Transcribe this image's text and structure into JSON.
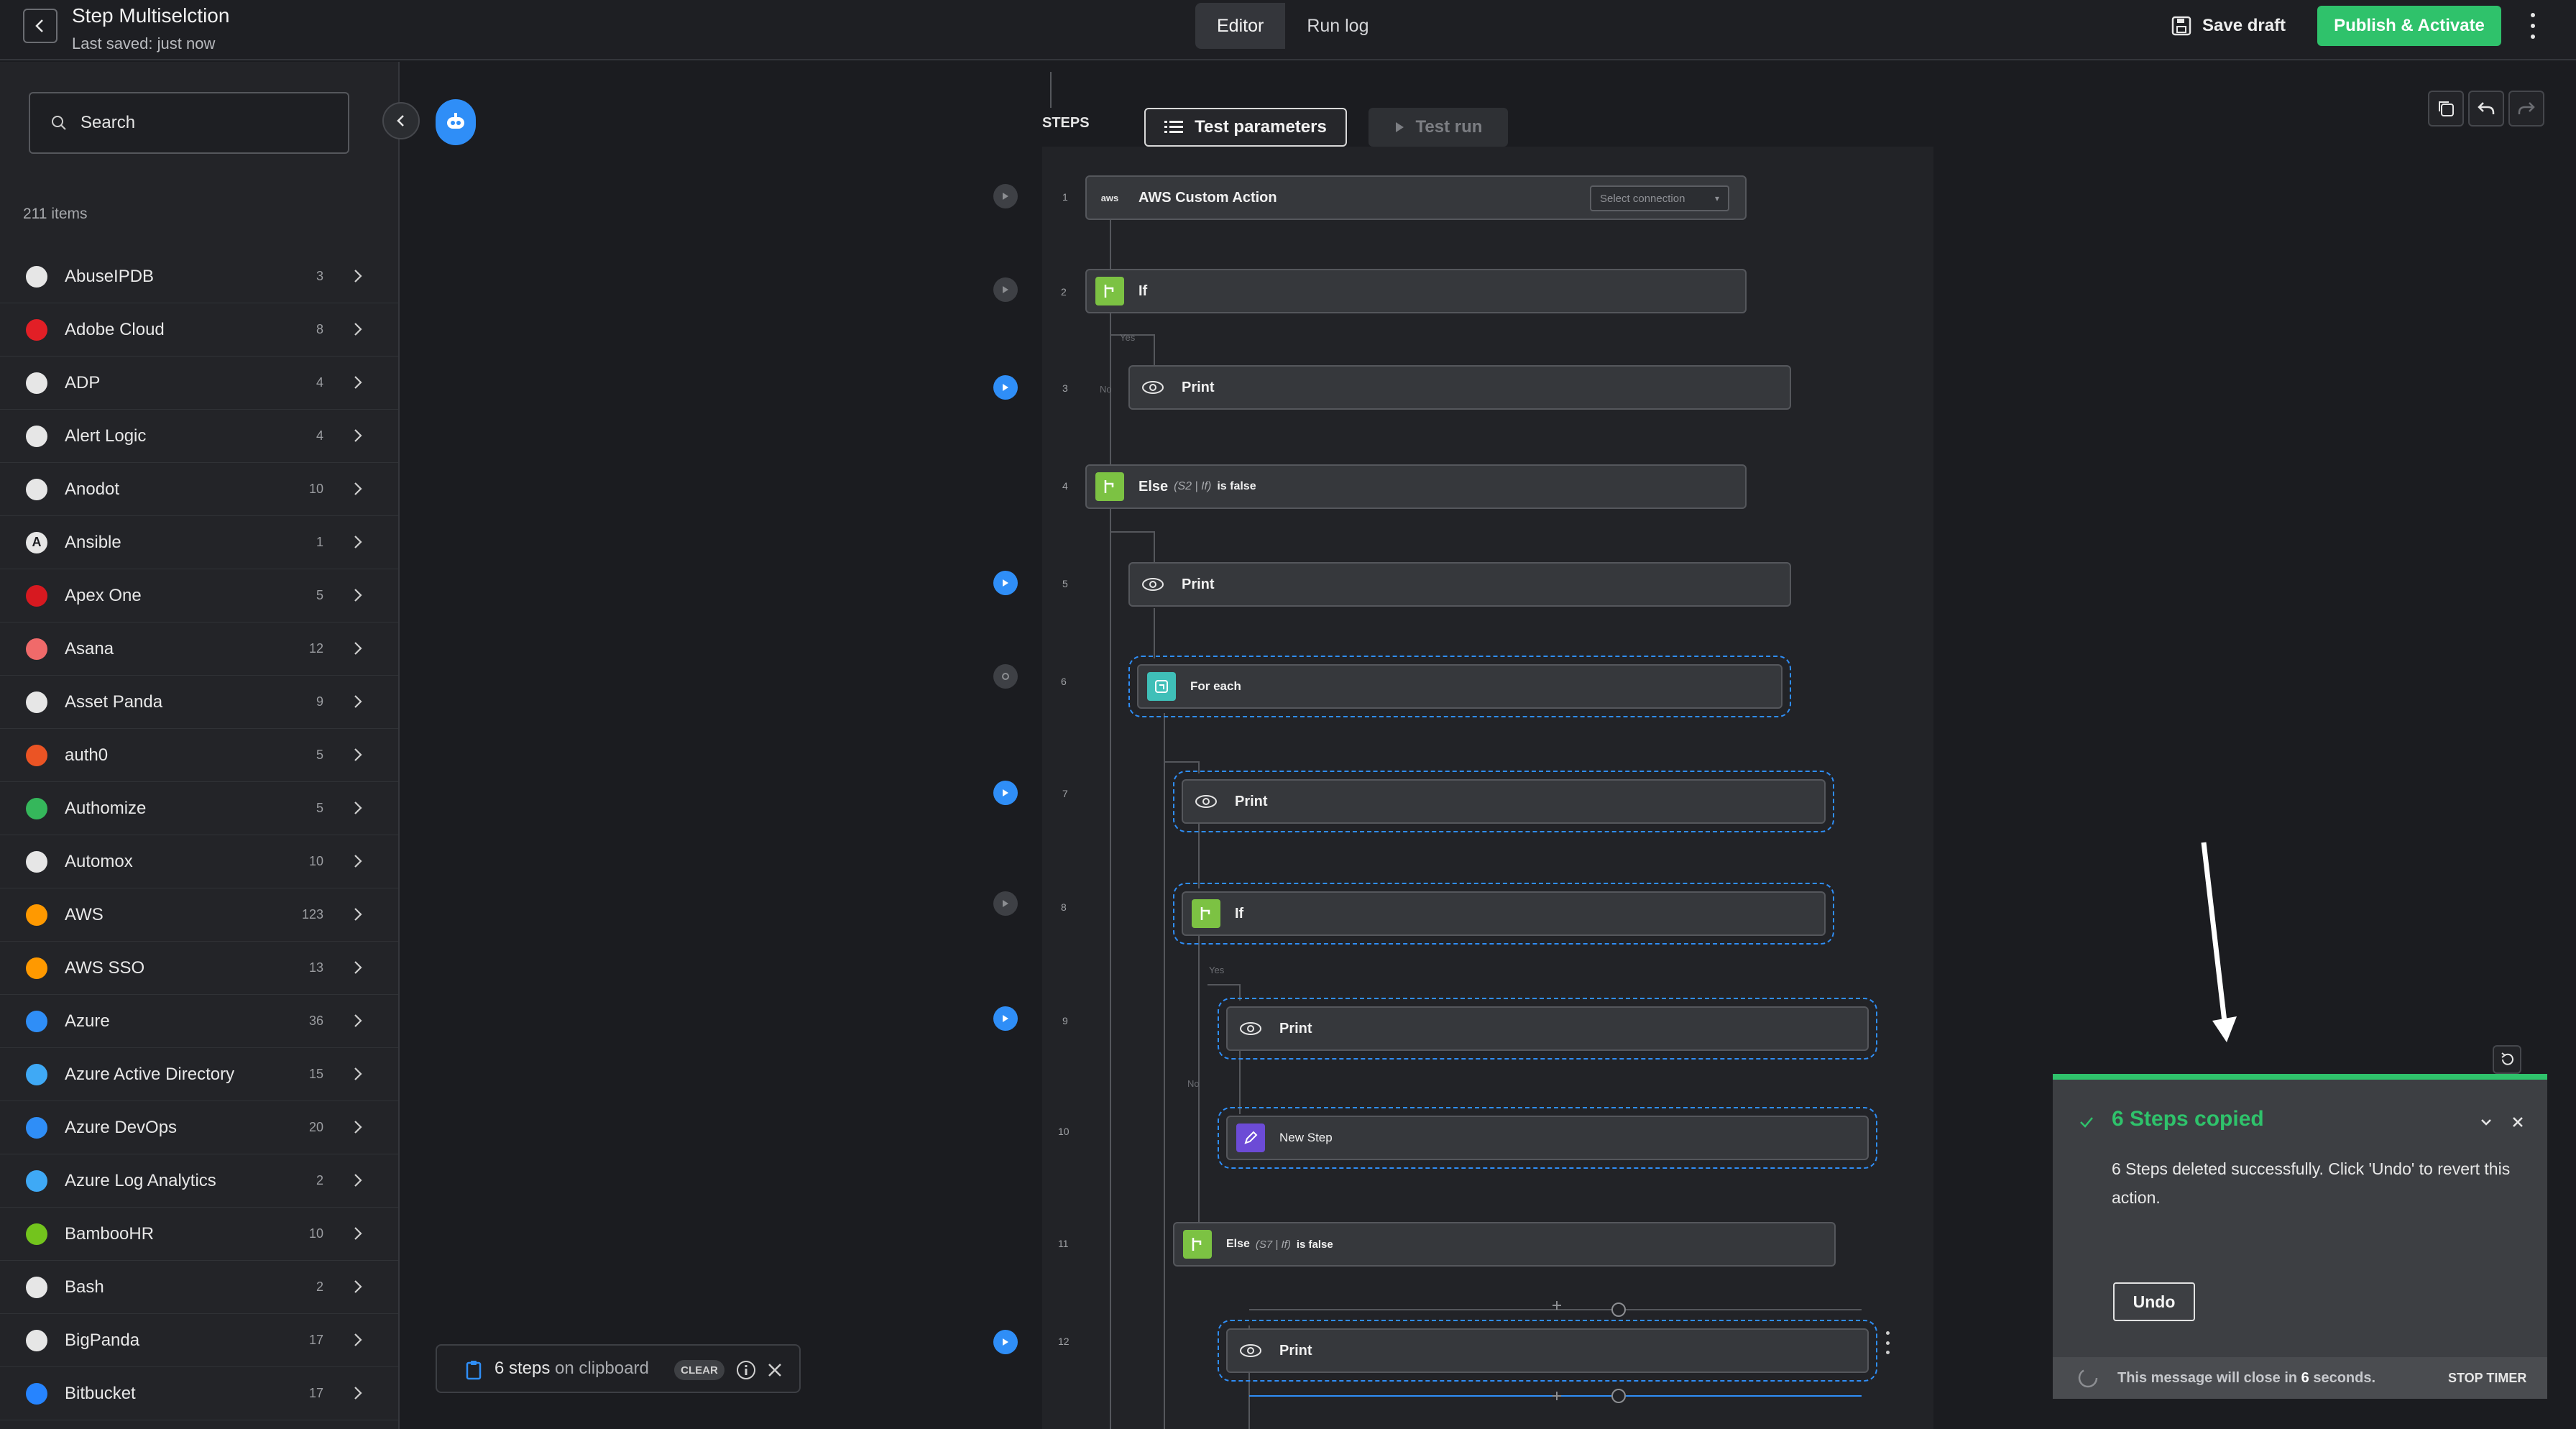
{
  "header": {
    "title": "Step Multiselction",
    "saved": "Last saved: just now",
    "tabs": [
      {
        "label": "Editor"
      },
      {
        "label": "Run log"
      }
    ],
    "save_draft": "Save draft",
    "publish": "Publish & Activate"
  },
  "sidebar": {
    "search_placeholder": "Search",
    "count": "211 items",
    "items": [
      {
        "name": "AbuseIPDB",
        "count": "3",
        "color": "#e6e6e6"
      },
      {
        "name": "Adobe Cloud",
        "count": "8",
        "color": "#e21f26"
      },
      {
        "name": "ADP",
        "count": "4",
        "color": "#e6e6e6"
      },
      {
        "name": "Alert Logic",
        "count": "4",
        "color": "#e6e6e6"
      },
      {
        "name": "Anodot",
        "count": "10",
        "color": "#e6e6e6"
      },
      {
        "name": "Ansible",
        "count": "1",
        "color": "#1b1c20"
      },
      {
        "name": "Apex One",
        "count": "5",
        "color": "#d71920"
      },
      {
        "name": "Asana",
        "count": "12",
        "color": "#f06a6a"
      },
      {
        "name": "Asset Panda",
        "count": "9",
        "color": "#e6e6e6"
      },
      {
        "name": "auth0",
        "count": "5",
        "color": "#eb5424"
      },
      {
        "name": "Authomize",
        "count": "5",
        "color": "#35b75b"
      },
      {
        "name": "Automox",
        "count": "10",
        "color": "#e6e6e6"
      },
      {
        "name": "AWS",
        "count": "123",
        "color": "#ff9900"
      },
      {
        "name": "AWS SSO",
        "count": "13",
        "color": "#ff9900"
      },
      {
        "name": "Azure",
        "count": "36",
        "color": "#2f8ef7"
      },
      {
        "name": "Azure Active Directory",
        "count": "15",
        "color": "#3fa9f5"
      },
      {
        "name": "Azure DevOps",
        "count": "20",
        "color": "#2f8ef7"
      },
      {
        "name": "Azure Log Analytics",
        "count": "2",
        "color": "#3fa9f5"
      },
      {
        "name": "BambooHR",
        "count": "10",
        "color": "#73c41d"
      },
      {
        "name": "Bash",
        "count": "2",
        "color": "#e6e6e6"
      },
      {
        "name": "BigPanda",
        "count": "17",
        "color": "#e6e6e6"
      },
      {
        "name": "Bitbucket",
        "count": "17",
        "color": "#2684ff"
      }
    ]
  },
  "canvas": {
    "steps_label": "STEPS",
    "test_params": "Test parameters",
    "test_run": "Test run",
    "select_connection": "Select connection",
    "steps": [
      {
        "num": "1",
        "label": "AWS Custom Action",
        "icon": "aws-icon"
      },
      {
        "num": "2",
        "label": "If",
        "icon": "branch-icon"
      },
      {
        "num": "3",
        "label": "Print",
        "icon": "eye-icon"
      },
      {
        "num": "4",
        "label": "Else",
        "sub": "(S2 | If)",
        "tail": "is false",
        "icon": "branch-icon"
      },
      {
        "num": "5",
        "label": "Print",
        "icon": "eye-icon"
      },
      {
        "num": "6",
        "label": "For each",
        "icon": "loop-icon"
      },
      {
        "num": "7",
        "label": "Print",
        "icon": "eye-icon"
      },
      {
        "num": "8",
        "label": "If",
        "icon": "branch-icon"
      },
      {
        "num": "9",
        "label": "Print",
        "icon": "eye-icon"
      },
      {
        "num": "10",
        "label": "New Step",
        "icon": "pencil-icon"
      },
      {
        "num": "11",
        "label": "Else",
        "sub": "(S7 | If)",
        "tail": "is false",
        "icon": "branch-icon"
      },
      {
        "num": "12",
        "label": "Print",
        "icon": "eye-icon"
      }
    ],
    "yes": "Yes",
    "no": "No"
  },
  "toast": {
    "title": "6 Steps copied",
    "message": "6 Steps deleted successfully. Click 'Undo' to revert this action.",
    "undo": "Undo",
    "close_prefix": "This message will close in ",
    "close_num": "6",
    "close_suffix": " seconds.",
    "stop": "STOP TIMER"
  },
  "clipboard": {
    "count": "6 steps",
    "suffix": " on clipboard",
    "clear": "CLEAR"
  }
}
